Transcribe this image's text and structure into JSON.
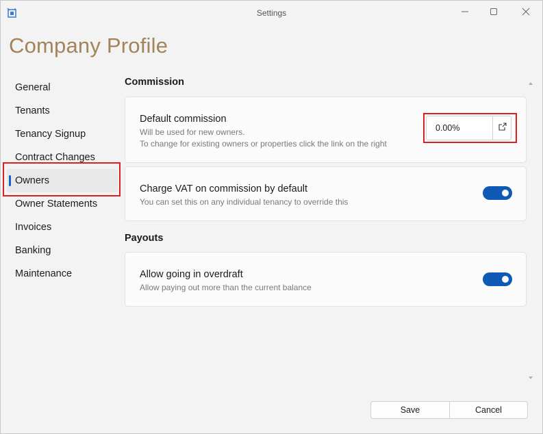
{
  "window": {
    "title": "Settings"
  },
  "page": {
    "title": "Company Profile"
  },
  "sidebar": {
    "items": [
      {
        "label": "General"
      },
      {
        "label": "Tenants"
      },
      {
        "label": "Tenancy Signup"
      },
      {
        "label": "Contract Changes"
      },
      {
        "label": "Owners"
      },
      {
        "label": "Owner Statements"
      },
      {
        "label": "Invoices"
      },
      {
        "label": "Banking"
      },
      {
        "label": "Maintenance"
      }
    ],
    "active": "Owners"
  },
  "commission": {
    "section_title": "Commission",
    "default": {
      "title": "Default commission",
      "desc_line1": "Will be used for new owners.",
      "desc_line2": "To change for existing owners or properties click the link on the right",
      "value": "0.00%"
    },
    "vat": {
      "title": "Charge VAT on commission by default",
      "desc": "You can set this on any individual tenancy to override this",
      "enabled": true
    }
  },
  "payouts": {
    "section_title": "Payouts",
    "overdraft": {
      "title": "Allow going in overdraft",
      "desc": "Allow paying out more than the current balance",
      "enabled": true
    }
  },
  "footer": {
    "save_label": "Save",
    "cancel_label": "Cancel"
  },
  "colors": {
    "accent": "#0f5ab5",
    "title": "#a3845a",
    "highlight": "#e01e1e"
  }
}
